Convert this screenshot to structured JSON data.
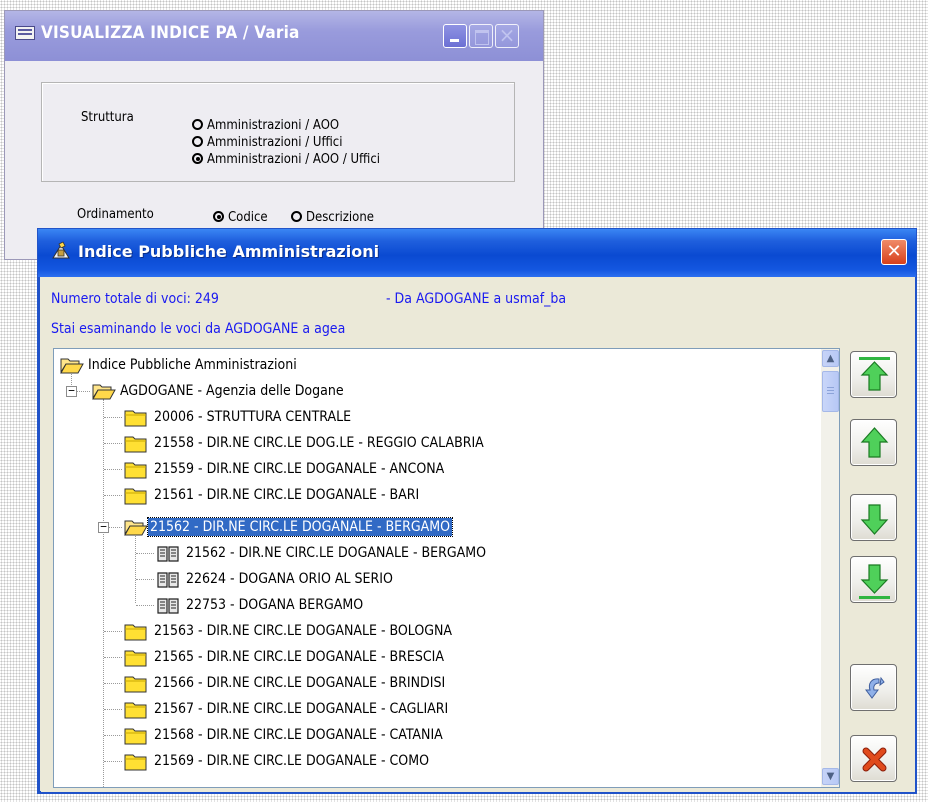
{
  "back_window": {
    "title": "VISUALIZZA INDICE PA / Varia",
    "struttura_label": "Struttura",
    "struttura_options": [
      "Amministrazioni / AOO",
      "Amministrazioni / Uffici",
      "Amministrazioni / AOO / Uffici"
    ],
    "struttura_selected": 2,
    "ordinamento_label": "Ordinamento",
    "ordinamento_options": [
      "Codice",
      "Descrizione"
    ],
    "ordinamento_selected": 0
  },
  "dialog": {
    "title": "Indice Pubbliche Amministrazioni",
    "total_label": "Numero totale di voci: 249",
    "range_label": "- Da AGDOGANE a usmaf_ba",
    "viewing_label": "Stai esaminando le voci da AGDOGANE a agea",
    "tree": {
      "root": "Indice Pubbliche Amministrazioni",
      "admin": "AGDOGANE - Agenzia delle Dogane",
      "aoo_before": [
        "20006 - STRUTTURA CENTRALE",
        "21558 - DIR.NE CIRC.LE DOG.LE - REGGIO CALABRIA",
        "21559 - DIR.NE CIRC.LE DOGANALE - ANCONA",
        "21561 - DIR.NE CIRC.LE DOGANALE - BARI"
      ],
      "selected_aoo": "21562 - DIR.NE CIRC.LE DOGANALE - BERGAMO",
      "offices": [
        "21562 - DIR.NE CIRC.LE DOGANALE - BERGAMO",
        "22624 - DOGANA ORIO AL SERIO",
        "22753 - DOGANA BERGAMO"
      ],
      "aoo_after": [
        "21563 - DIR.NE CIRC.LE DOGANALE - BOLOGNA",
        "21565 - DIR.NE CIRC.LE DOGANALE - BRESCIA",
        "21566 - DIR.NE CIRC.LE DOGANALE - BRINDISI",
        "21567 - DIR.NE CIRC.LE DOGANALE - CAGLIARI",
        "21568 - DIR.NE CIRC.LE DOGANALE - CATANIA",
        "21569 - DIR.NE CIRC.LE DOGANALE - COMO"
      ]
    },
    "buttons": [
      "first-page",
      "previous-page",
      "next-page",
      "last-page",
      "refresh",
      "close"
    ],
    "colors": {
      "accent_blue": "#1a1af0",
      "selection": "#316ac5",
      "arrow_green": "#2fb540",
      "close_red": "#e04a1c"
    }
  }
}
